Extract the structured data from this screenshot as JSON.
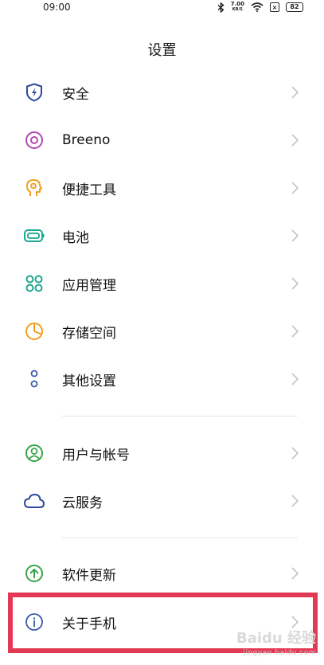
{
  "status_bar": {
    "time": "09:00",
    "net_speed_value": "7.00",
    "net_speed_unit": "KB/S",
    "battery": "82"
  },
  "header": {
    "title": "设置"
  },
  "settings": {
    "security": "安全",
    "breeno": "Breeno",
    "convenience_tools": "便捷工具",
    "battery": "电池",
    "app_management": "应用管理",
    "storage": "存储空间",
    "other_settings": "其他设置",
    "users_accounts": "用户与帐号",
    "cloud_service": "云服务",
    "software_update": "软件更新",
    "about_phone": "关于手机"
  },
  "colors": {
    "security_icon": "#2d4a9e",
    "breeno_icon": "#b24ab1",
    "tools_icon": "#f0a020",
    "battery_icon": "#1aa88f",
    "apps_icon": "#1aa88f",
    "storage_icon": "#f0a020",
    "other_icon": "#3b5ca8",
    "user_icon": "#3aa34a",
    "cloud_icon": "#2d4a9e",
    "update_icon": "#3aa34a",
    "about_icon": "#3b5ca8",
    "highlight": "#e23a55"
  },
  "watermark": {
    "main": "Baidu 经验",
    "sub": "jingyan.baidu.com"
  }
}
